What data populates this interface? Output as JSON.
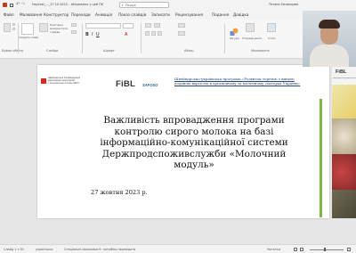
{
  "window": {
    "title": "Наукові_..._27.10.2023 – збережено у цей ПК",
    "search_placeholder": "Пошук",
    "user": "Тетяна Ємлянцева"
  },
  "menu": [
    "Файл",
    "Малювання",
    "Конструктор",
    "Переходи",
    "Анімація",
    "Показ слайдів",
    "Записати",
    "Рецензування",
    "Подання",
    "Довідка"
  ],
  "ribbon": {
    "clipboard": {
      "label": "Буфер обміну"
    },
    "slides": {
      "label": "Слайди",
      "new_slide": "Створити слайд",
      "reuse": "Повторно використати слайди"
    },
    "font": {
      "label": "Шрифт"
    },
    "paragraph": {
      "label": "Абзац"
    },
    "drawing": {
      "label": "Малювання",
      "shapes": "Фігури",
      "arrange": "Упорядкувати",
      "styles": "Стилі"
    }
  },
  "slide": {
    "header_text_line1": "Швейцарсько-українська програма «Розвиток торгівлі з вищою",
    "header_text_line2": "доданою вартістю в органічному та молочному секторах України»",
    "swiss_lines": [
      "Швейцарська Конфедерація",
      "Державний секретаріат",
      "з економічних питань SECO"
    ],
    "fibl_logo": "FiBL",
    "safosc_logo": "SAFOSO",
    "title": "Важливість впровадження програми контролю сирого молока на базі інформаційно-комунікаційної системи Держпродспоживслужби «Молочний модуль»",
    "date": "27 жовтня 2023 р."
  },
  "side_panel": {
    "fibl_logo": "FiBL",
    "caption": "Швейцарсько-українська програма..."
  },
  "status": {
    "left": "Слайд 1 з 30",
    "language": "українська",
    "accessibility": "Спеціальні можливості: потрібно перевірити",
    "notes": "Нотатки"
  },
  "colors": {
    "accent": "#c43e1c",
    "swiss_red": "#d52b1e",
    "fibl_green": "#7ab648",
    "ribbon_bg": "#f7f7f7"
  }
}
